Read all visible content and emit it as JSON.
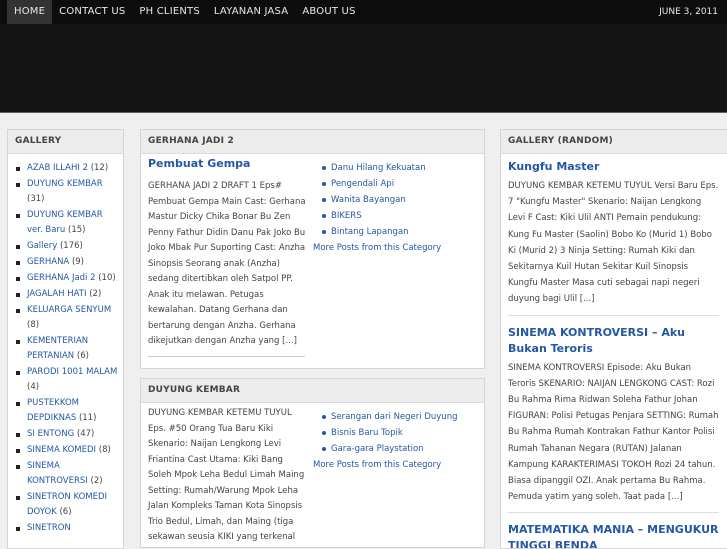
{
  "nav": {
    "items": [
      {
        "label": "HOME"
      },
      {
        "label": "CONTACT US"
      },
      {
        "label": "PH CLIENTS"
      },
      {
        "label": "LAYANAN JASA"
      },
      {
        "label": "ABOUT US"
      }
    ],
    "date": "JUNE 3, 2011"
  },
  "gallery": {
    "title": "GALLERY",
    "items": [
      {
        "label": "AZAB ILLAHI 2",
        "count": "(12)"
      },
      {
        "label": "DUYUNG KEMBAR",
        "count": "(31)"
      },
      {
        "label": "DUYUNG KEMBAR ver. Baru",
        "count": "(15)"
      },
      {
        "label": "Gallery",
        "count": "(176)"
      },
      {
        "label": "GERHANA",
        "count": "(9)"
      },
      {
        "label": "GERHANA Jadi 2",
        "count": "(10)"
      },
      {
        "label": "JAGALAH HATI",
        "count": "(2)"
      },
      {
        "label": "KELUARGA SENYUM",
        "count": "(8)"
      },
      {
        "label": "KEMENTERIAN PERTANIAN",
        "count": "(6)"
      },
      {
        "label": "PARODI 1001 MALAM",
        "count": "(4)"
      },
      {
        "label": "PUSTEKKOM DEPDIKNAS",
        "count": "(11)"
      },
      {
        "label": "SI ENTONG",
        "count": "(47)"
      },
      {
        "label": "SINEMA KOMEDI",
        "count": "(8)"
      },
      {
        "label": "SINEMA KONTROVERSI",
        "count": "(2)"
      },
      {
        "label": "SINETRON KOMEDI DOYOK",
        "count": "(6)"
      },
      {
        "label": "SINETRON",
        "count": ""
      }
    ]
  },
  "cat1": {
    "title": "GERHANA JADI 2",
    "post_title": "Pembuat Gempa",
    "excerpt": "GERHANA JADI 2 DRAFT 1 Eps# Pembuat Gempa Main Cast: Gerhana Mastur Dicky Chika Bonar Bu Zen Penny Fathur Didin Danu Pak Joko Bu Joko Mbak Pur Suporting Cast: Anzha Sinopsis Seorang anak (Anzha) sedang ditertibkan oleh Satpol PP. Anak itu melawan. Petugas kewalahan. Datang Gerhana dan bertarung dengan Anzha. Gerhana dikejutkan dengan Anzha yang [...]",
    "links": [
      "Danu Hilang Kekuatan",
      "Pengendali Api",
      "Wanita Bayangan",
      "BIKERS",
      "Bintang Lapangan"
    ],
    "more": "More Posts from this Category"
  },
  "cat2": {
    "title": "DUYUNG KEMBAR",
    "excerpt": "DUYUNG KEMBAR KETEMU TUYUL Eps. #50 Orang Tua Baru Kiki Skenario: Naijan Lengkong Levi Friantina Cast Utama: Kiki Bang Soleh Mpok Leha Bedul Limah Maing Setting: Rumah/Warung Mpok Leha Jalan Kompleks Taman Kota Sinopsis Trio Bedul, Limah, dan Maing (tiga sekawan seusia KIKI yang terkenal",
    "links": [
      "Serangan dari Negeri Duyung",
      "Bisnis Baru Topik",
      "Gara-gara Playstation"
    ],
    "more": "More Posts from this Category"
  },
  "random": {
    "title": "GALLERY (RANDOM)",
    "entries": [
      {
        "title": "Kungfu Master",
        "text": "DUYUNG KEMBAR KETEMU TUYUL Versi Baru Eps. 7 \"Kungfu Master\" Skenario: Naijan Lengkong Levi F Cast: Kiki Ulil ANTI Pemain pendukung: Kung Fu Master (Saolin) Bobo Ko (Murid 1) Bobo Ki (Murid 2) 3 Ninja Setting: Rumah Kiki dan Sekitarnya Kuil Hutan Sekitar Kuil Sinopsis Kungfu Master Masa cuti sebagai napi negeri duyung bagi Ulil [...]"
      },
      {
        "title": "SINEMA KONTROVERSI – Aku Bukan Teroris",
        "text": "SINEMA KONTROVERSI Episode: Aku Bukan Teroris SKENARIO: NAIJAN LENGKONG CAST: Rozi Bu Rahma Rima Ridwan Soleha Fathur Johan FIGURAN: Polisi Petugas Penjara SETTING: Rumah Bu Rahma Rumah Kontrakan Fathur Kantor Polisi Rumah Tahanan Negara (RUTAN) Jalanan Kampung KARAKTERIMASI TOKOH Rozi 24 tahun. Biasa dipanggil OZI. Anak pertama Bu Rahma. Pemuda yatim yang soleh. Taat pada [...]"
      },
      {
        "title": "MATEMATIKA MANIA – MENGUKUR TINGGI BENDA",
        "text": ""
      }
    ]
  }
}
